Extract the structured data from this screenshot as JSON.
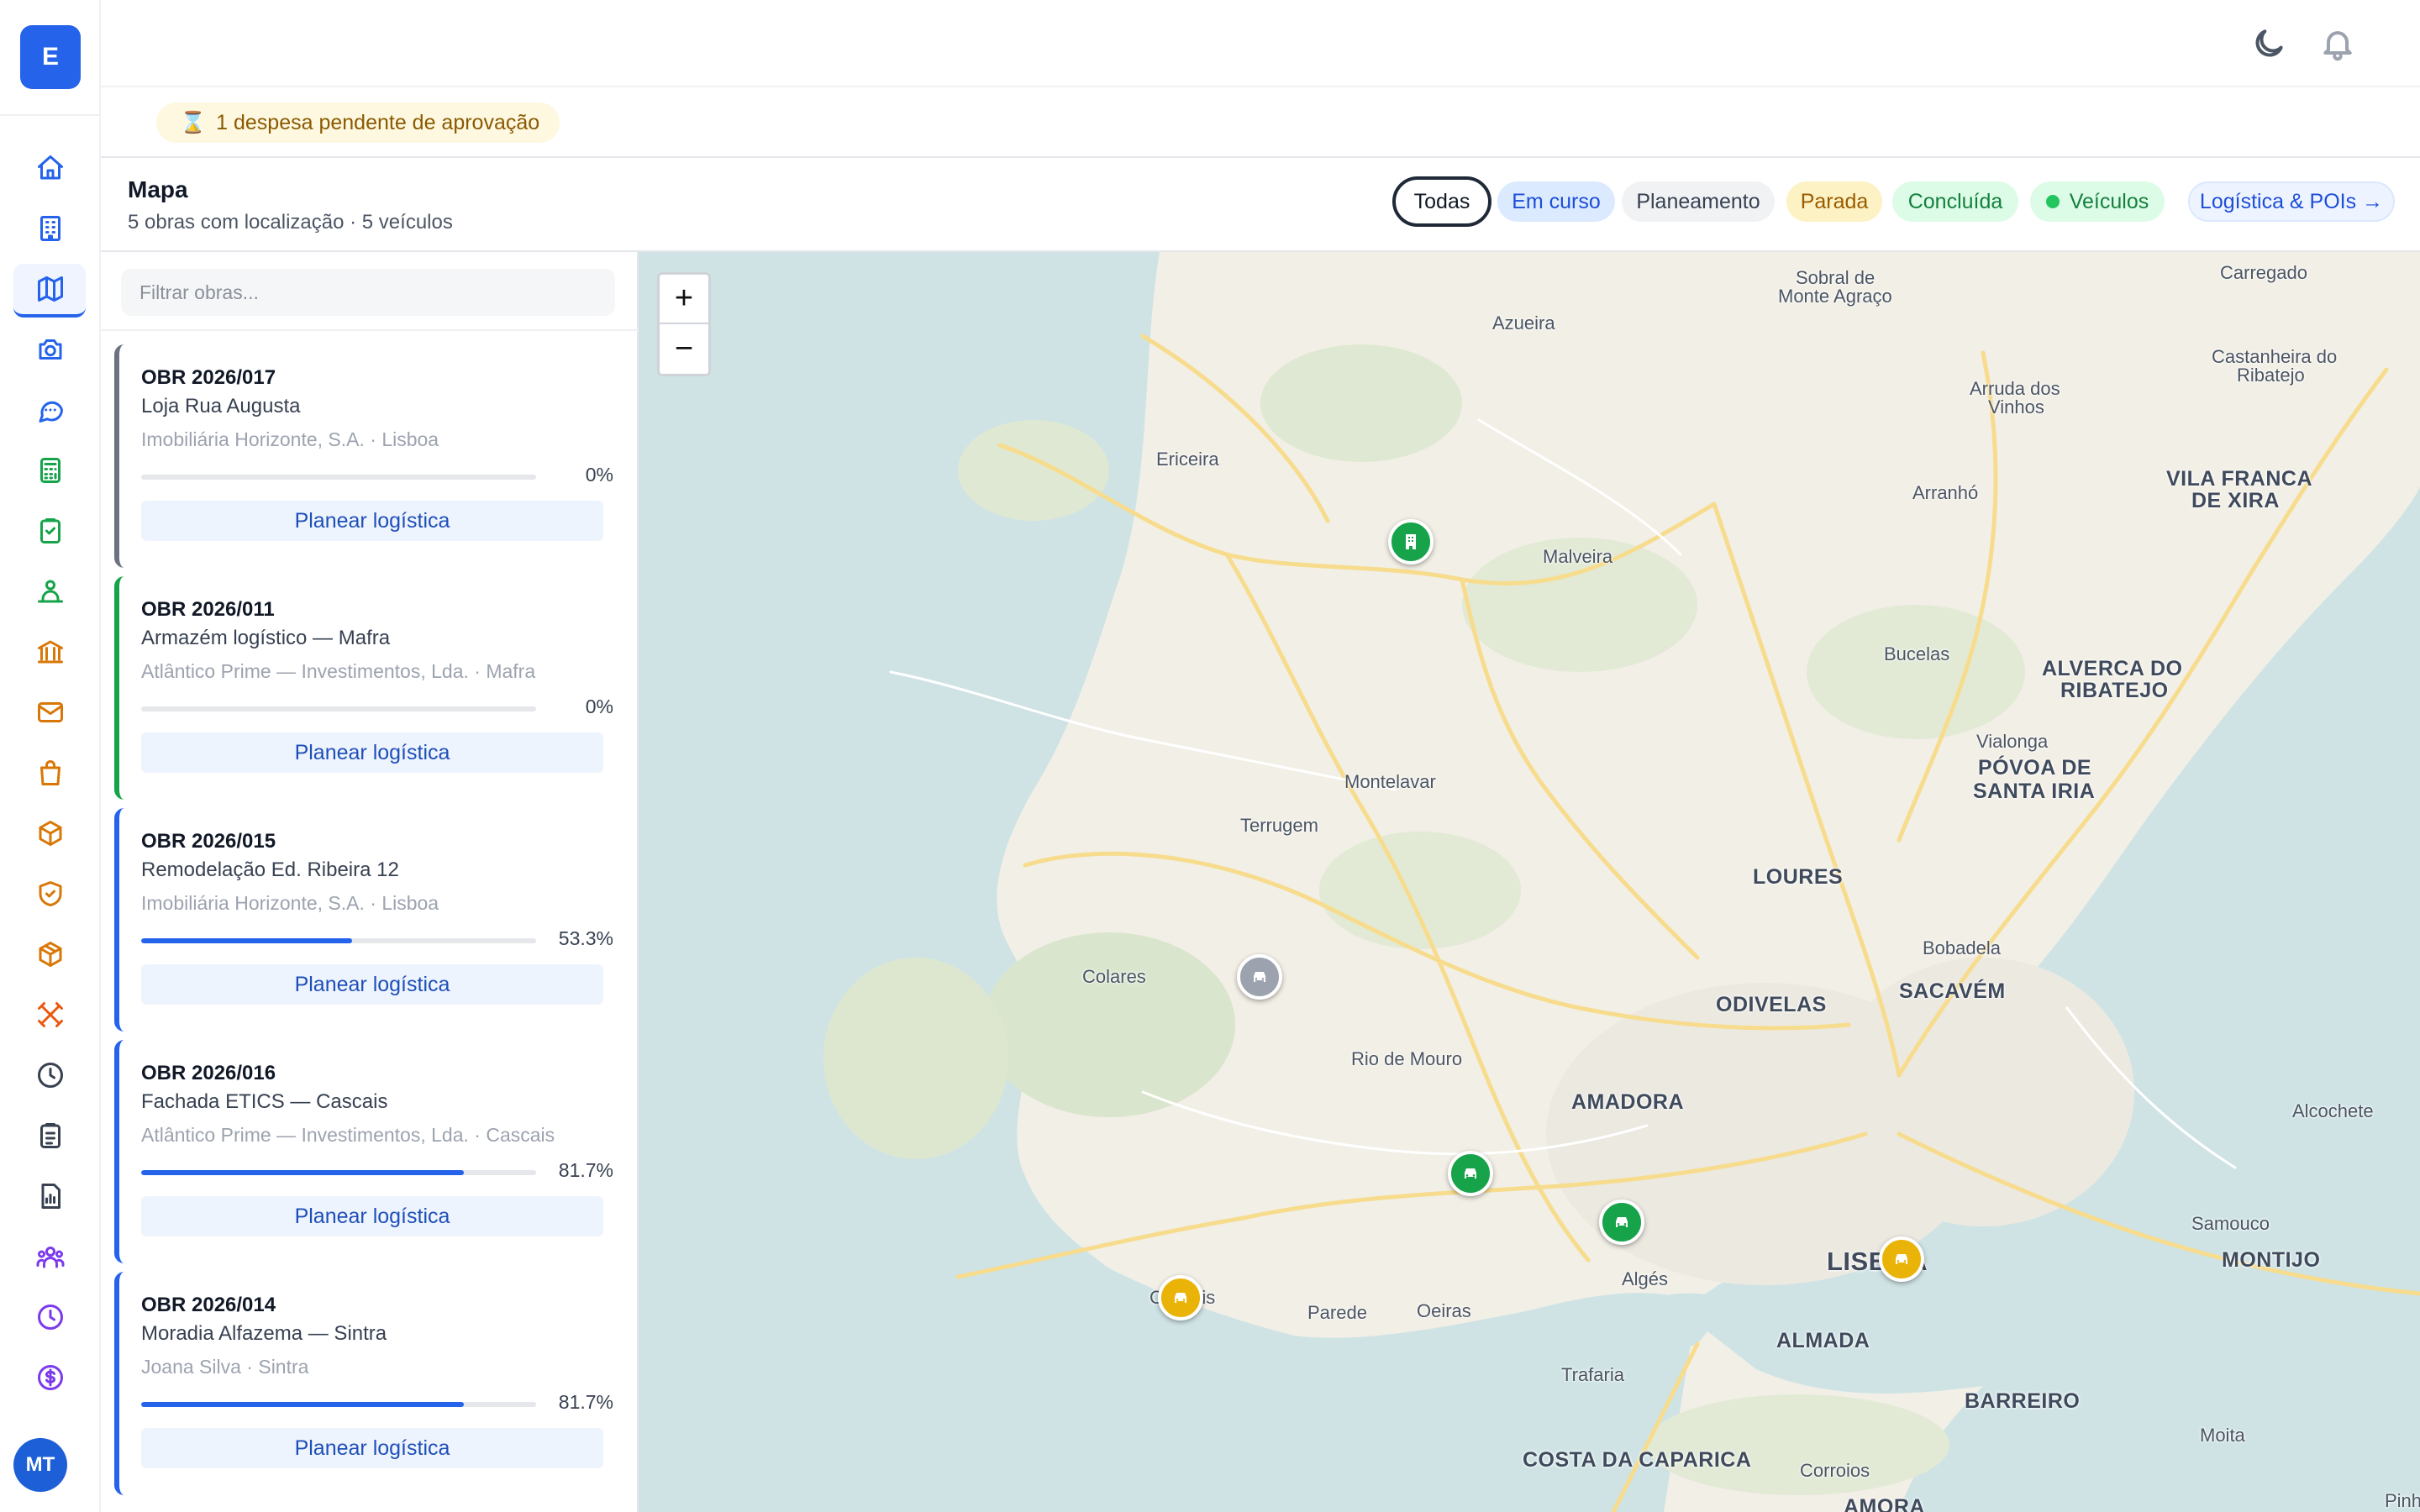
{
  "app": {
    "logo_letter": "E",
    "user_initials": "MT"
  },
  "alerts": {
    "pending": "1 despesa pendente de aprovação",
    "pending_icon": "hourglass-icon"
  },
  "header": {
    "title": "Mapa",
    "subtitle": "5 obras com localização · 5 veículos",
    "filters": [
      "Todas",
      "Em curso",
      "Planeamento",
      "Parada",
      "Concluída",
      "Veículos",
      "Logística & POIs →"
    ],
    "active_filter": "Todas"
  },
  "list": {
    "filter_placeholder": "Filtrar obras...",
    "plan_label": "Planear logística",
    "cards": [
      {
        "code": "OBR 2026/017",
        "name": "Loja Rua Augusta",
        "client": "Imobiliária Horizonte, S.A. · Lisboa",
        "progress_pct": 0,
        "progress_text": "0%",
        "status_color": "#6b7280"
      },
      {
        "code": "OBR 2026/011",
        "name": "Armazém logístico — Mafra",
        "client": "Atlântico Prime — Investimentos, Lda. · Mafra",
        "progress_pct": 0,
        "progress_text": "0%",
        "status_color": "#16a34a"
      },
      {
        "code": "OBR 2026/015",
        "name": "Remodelação Ed. Ribeira 12",
        "client": "Imobiliária Horizonte, S.A. · Lisboa",
        "progress_pct": 53.3,
        "progress_text": "53.3%",
        "status_color": "#2563eb"
      },
      {
        "code": "OBR 2026/016",
        "name": "Fachada ETICS — Cascais",
        "client": "Atlântico Prime — Investimentos, Lda. · Cascais",
        "progress_pct": 81.7,
        "progress_text": "81.7%",
        "status_color": "#2563eb"
      },
      {
        "code": "OBR 2026/014",
        "name": "Moradia Alfazema — Sintra",
        "client": "Joana Silva · Sintra",
        "progress_pct": 81.7,
        "progress_text": "81.7%",
        "status_color": "#2563eb"
      }
    ]
  },
  "map": {
    "zoom_in": "+",
    "zoom_out": "−",
    "places": {
      "sobral": "Sobral de",
      "sobral2": "Monte Agraço",
      "carregado": "Carregado",
      "azueira": "Azueira",
      "castanheira": "Castanheira do",
      "castanheira2": "Ribatejo",
      "arruda": "Arruda dos",
      "arruda2": "Vinhos",
      "ericeira": "Ericeira",
      "arranho": "Arranhó",
      "vilafranca": "VILA FRANCA",
      "vilafranca2": "DE XIRA",
      "malveira": "Malveira",
      "bucelas": "Bucelas",
      "alverca": "ALVERCA DO",
      "alverca2": "RIBATEJO",
      "vialonga": "Vialonga",
      "povoa": "PÓVOA DE",
      "povoa2": "SANTA IRIA",
      "montelavar": "Montelavar",
      "terrugem": "Terrugem",
      "loures": "LOURES",
      "bobadela": "Bobadela",
      "colares": "Colares",
      "odivelas": "ODIVELAS",
      "sacavem": "SACAVÉM",
      "riomouro": "Rio de Mouro",
      "amadora": "AMADORA",
      "alcochete": "Alcochete",
      "samouco": "Samouco",
      "lisboa": "LISBOA",
      "montijo": "MONTIJO",
      "cascais": "Cascais",
      "parede": "Parede",
      "oeiras": "Oeiras",
      "alges": "Algés",
      "almada": "ALMADA",
      "trafaria": "Trafaria",
      "barreiro": "BARREIRO",
      "costa": "COSTA DA CAPARICA",
      "corroios": "Corroios",
      "moita": "Moita",
      "amora": "AMORA",
      "pinhal": "Pinha"
    },
    "markers": [
      {
        "type": "building",
        "color": "#16a34a"
      },
      {
        "type": "vehicle",
        "color": "#9ca3af"
      },
      {
        "type": "vehicle",
        "color": "#16a34a"
      },
      {
        "type": "vehicle",
        "color": "#16a34a"
      },
      {
        "type": "vehicle",
        "color": "#eab308"
      },
      {
        "type": "vehicle",
        "color": "#eab308"
      }
    ]
  }
}
